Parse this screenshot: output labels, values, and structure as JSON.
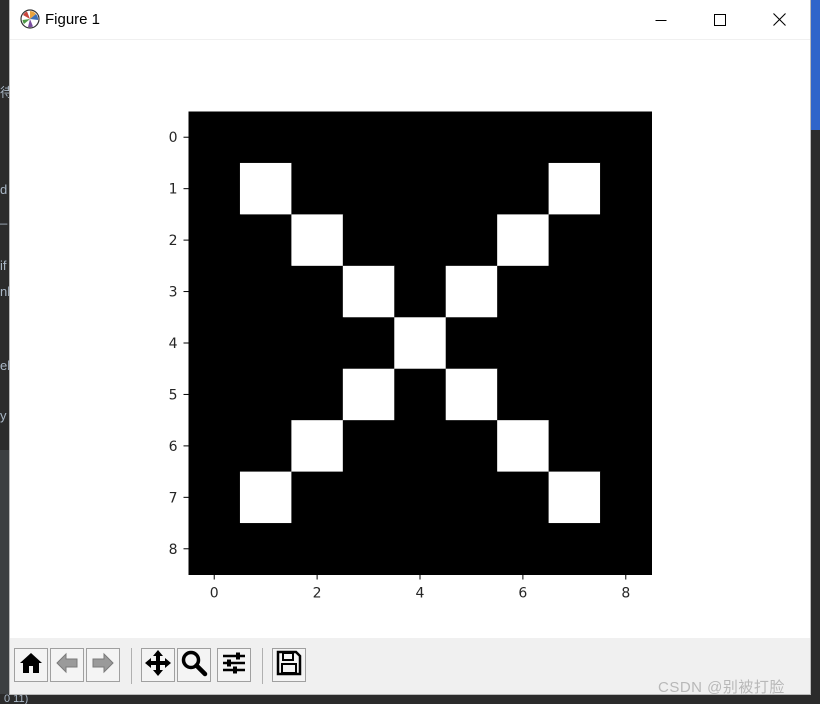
{
  "window": {
    "title": "Figure 1",
    "controls": [
      "minimize-icon",
      "maximize-icon",
      "close-icon"
    ]
  },
  "toolbar": {
    "buttons": [
      {
        "name": "home",
        "icon": "home-icon"
      },
      {
        "name": "back",
        "icon": "arrow-left-icon"
      },
      {
        "name": "forward",
        "icon": "arrow-right-icon"
      },
      {
        "name": "pan",
        "icon": "move-icon"
      },
      {
        "name": "zoom",
        "icon": "magnifier-icon"
      },
      {
        "name": "configure-subplots",
        "icon": "sliders-icon"
      },
      {
        "name": "save",
        "icon": "floppy-disk-icon"
      }
    ]
  },
  "watermark": "CSDN @别被打脸",
  "background_fragments": [
    "待",
    "d",
    "_",
    "if",
    "nh",
    "el",
    "y",
    "0 11)"
  ],
  "chart_data": {
    "type": "heatmap",
    "cmap": "gray",
    "rows": 9,
    "cols": 9,
    "matrix": [
      [
        0,
        0,
        0,
        0,
        0,
        0,
        0,
        0,
        0
      ],
      [
        0,
        1,
        0,
        0,
        0,
        0,
        0,
        1,
        0
      ],
      [
        0,
        0,
        1,
        0,
        0,
        0,
        1,
        0,
        0
      ],
      [
        0,
        0,
        0,
        1,
        0,
        1,
        0,
        0,
        0
      ],
      [
        0,
        0,
        0,
        0,
        1,
        0,
        0,
        0,
        0
      ],
      [
        0,
        0,
        0,
        1,
        0,
        1,
        0,
        0,
        0
      ],
      [
        0,
        0,
        1,
        0,
        0,
        0,
        1,
        0,
        0
      ],
      [
        0,
        1,
        0,
        0,
        0,
        0,
        0,
        1,
        0
      ],
      [
        0,
        0,
        0,
        0,
        0,
        0,
        0,
        0,
        0
      ]
    ],
    "xticks": [
      0,
      2,
      4,
      6,
      8
    ],
    "yticks": [
      0,
      1,
      2,
      3,
      4,
      5,
      6,
      7,
      8
    ],
    "xlim": [
      -0.5,
      8.5
    ],
    "ylim": [
      8.5,
      -0.5
    ],
    "colors": {
      "on": "#ffffff",
      "off": "#000000",
      "tick_text": "#262626"
    }
  }
}
